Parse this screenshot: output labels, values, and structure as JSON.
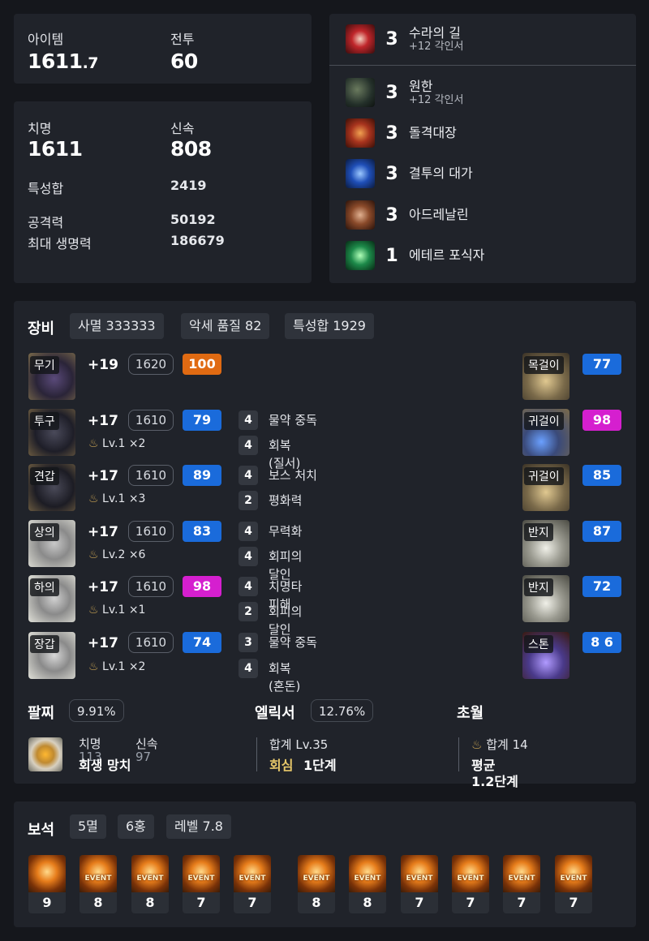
{
  "summary": {
    "item_label": "아이템",
    "item_main": "1611",
    "item_dec": ".7",
    "combat_label": "전투",
    "combat_value": "60"
  },
  "stats": {
    "crit_label": "치명",
    "crit_value": "1611",
    "swift_label": "신속",
    "swift_value": "808",
    "total_label": "특성합",
    "total_value": "2419",
    "atk_label": "공격력",
    "atk_value": "50192",
    "hp_label": "최대 생명력",
    "hp_value": "186679"
  },
  "engravings": [
    {
      "level": "3",
      "name": "수라의 길",
      "sub": "+12 각인서",
      "icon": "sura-icon",
      "color": "#c0262b"
    },
    {
      "level": "3",
      "name": "원한",
      "sub": "+12 각인서",
      "icon": "grudge-icon",
      "color": "#3a4a3e"
    },
    {
      "level": "3",
      "name": "돌격대장",
      "sub": "",
      "icon": "raid-captain-icon",
      "color": "#a8341e"
    },
    {
      "level": "3",
      "name": "결투의 대가",
      "sub": "",
      "icon": "duel-master-icon",
      "color": "#1f4fb8"
    },
    {
      "level": "3",
      "name": "아드레날린",
      "sub": "",
      "icon": "adrenaline-icon",
      "color": "#8a4a2a"
    },
    {
      "level": "1",
      "name": "에테르 포식자",
      "sub": "",
      "icon": "ether-predator-icon",
      "color": "#1d8a4a"
    }
  ],
  "equipment": {
    "title": "장비",
    "chips": [
      "사멸 333333",
      "악세 품질 82",
      "특성합 1929"
    ],
    "left": [
      {
        "slot": "무기",
        "refine": "+19",
        "ilvl": "1620",
        "quality": "100",
        "qcolor": "orange",
        "trans": "",
        "abil": []
      },
      {
        "slot": "투구",
        "refine": "+17",
        "ilvl": "1610",
        "quality": "79",
        "qcolor": "blue",
        "trans": "Lv.1 ×2",
        "abil": [
          {
            "n": "4",
            "t": "물약 중독"
          },
          {
            "n": "4",
            "t": "회복 (질서)"
          }
        ]
      },
      {
        "slot": "견갑",
        "refine": "+17",
        "ilvl": "1610",
        "quality": "89",
        "qcolor": "blue",
        "trans": "Lv.1 ×3",
        "abil": [
          {
            "n": "4",
            "t": "보스 처치"
          },
          {
            "n": "2",
            "t": "평화력"
          }
        ]
      },
      {
        "slot": "상의",
        "refine": "+17",
        "ilvl": "1610",
        "quality": "83",
        "qcolor": "blue",
        "trans": "Lv.2 ×6",
        "abil": [
          {
            "n": "4",
            "t": "무력화"
          },
          {
            "n": "4",
            "t": "회피의 달인"
          }
        ]
      },
      {
        "slot": "하의",
        "refine": "+17",
        "ilvl": "1610",
        "quality": "98",
        "qcolor": "pink",
        "trans": "Lv.1 ×1",
        "abil": [
          {
            "n": "4",
            "t": "치명타 피해"
          },
          {
            "n": "2",
            "t": "회피의 달인"
          }
        ]
      },
      {
        "slot": "장갑",
        "refine": "+17",
        "ilvl": "1610",
        "quality": "74",
        "qcolor": "blue",
        "trans": "Lv.1 ×2",
        "abil": [
          {
            "n": "3",
            "t": "물약 중독"
          },
          {
            "n": "4",
            "t": "회복 (혼돈)"
          }
        ]
      }
    ],
    "right": [
      {
        "slot": "목걸이",
        "quality": "77",
        "qcolor": "blue"
      },
      {
        "slot": "귀걸이",
        "quality": "98",
        "qcolor": "pink"
      },
      {
        "slot": "귀걸이",
        "quality": "85",
        "qcolor": "blue"
      },
      {
        "slot": "반지",
        "quality": "87",
        "qcolor": "blue"
      },
      {
        "slot": "반지",
        "quality": "72",
        "qcolor": "blue"
      },
      {
        "slot": "스톤",
        "quality": "8 6",
        "qcolor": "blue"
      }
    ]
  },
  "bracelet": {
    "title": "팔찌",
    "chip": "9.91%",
    "stat1_label": "치명",
    "stat1_value": "113",
    "stat2_label": "신속",
    "stat2_value": "97",
    "effect": "회생 망치"
  },
  "elixir": {
    "title": "엘릭서",
    "chip": "12.76%",
    "total": "합계 Lv.35",
    "effect_name": "회심",
    "effect_level": "1단계"
  },
  "transcend": {
    "title": "초월",
    "total": "합계 14",
    "avg_label": "평균",
    "avg_value": "1.2단계"
  },
  "gems": {
    "title": "보석",
    "chips": [
      "5멸",
      "6홍",
      "레벨 7.8"
    ],
    "items": [
      {
        "level": "9",
        "event": false,
        "kind": "destruction"
      },
      {
        "level": "8",
        "event": true,
        "kind": "destruction"
      },
      {
        "level": "8",
        "event": true,
        "kind": "destruction"
      },
      {
        "level": "7",
        "event": true,
        "kind": "destruction"
      },
      {
        "level": "7",
        "event": true,
        "kind": "destruction"
      },
      {
        "level": "8",
        "event": true,
        "kind": "crimson"
      },
      {
        "level": "8",
        "event": true,
        "kind": "crimson"
      },
      {
        "level": "7",
        "event": true,
        "kind": "crimson"
      },
      {
        "level": "7",
        "event": true,
        "kind": "crimson"
      },
      {
        "level": "7",
        "event": true,
        "kind": "crimson"
      },
      {
        "level": "7",
        "event": true,
        "kind": "crimson"
      }
    ],
    "event_label": "EVENT"
  },
  "colors": {
    "accent_blue": "#1a6bdb",
    "accent_pink": "#d51fcf",
    "accent_orange": "#e06a12",
    "panel": "#20232a",
    "background": "#15171c"
  }
}
